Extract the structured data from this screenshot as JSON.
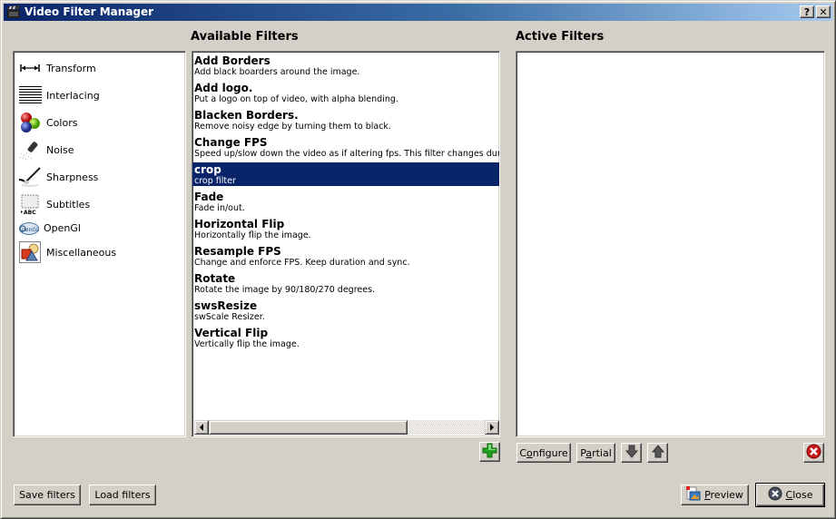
{
  "window": {
    "title": "Video Filter Manager",
    "help_button": "?",
    "close_button": "✕"
  },
  "categories": {
    "items": [
      {
        "label": "Transform",
        "icon": "transform-arrow-icon"
      },
      {
        "label": "Interlacing",
        "icon": "interlacing-lines-icon"
      },
      {
        "label": "Colors",
        "icon": "colors-balls-icon"
      },
      {
        "label": "Noise",
        "icon": "noise-brush-icon"
      },
      {
        "label": "Sharpness",
        "icon": "sharpness-brush-icon"
      },
      {
        "label": "Subtitles",
        "icon": "subtitles-abc-icon"
      },
      {
        "label": "OpenGl",
        "icon": "opengl-logo-icon"
      },
      {
        "label": "Miscellaneous",
        "icon": "misc-shapes-icon"
      }
    ]
  },
  "available": {
    "heading": "Available Filters",
    "selected_index": 4,
    "filters": [
      {
        "name": "Add Borders",
        "desc": "Add black boarders around the image."
      },
      {
        "name": "Add logo.",
        "desc": "Put a logo on top of video, with alpha blending."
      },
      {
        "name": "Blacken Borders.",
        "desc": "Remove noisy edge by turning them to black."
      },
      {
        "name": "Change FPS",
        "desc": "Speed up/slow down the video as if altering fps. This filter changes duration."
      },
      {
        "name": "crop",
        "desc": "crop filter"
      },
      {
        "name": "Fade",
        "desc": "Fade in/out."
      },
      {
        "name": "Horizontal Flip",
        "desc": "Horizontally flip the image."
      },
      {
        "name": "Resample FPS",
        "desc": "Change and enforce FPS. Keep duration and sync."
      },
      {
        "name": "Rotate",
        "desc": "Rotate the image by 90/180/270 degrees."
      },
      {
        "name": "swsResize",
        "desc": "swScale Resizer."
      },
      {
        "name": "Vertical Flip",
        "desc": "Vertically flip the image."
      }
    ]
  },
  "active": {
    "heading": "Active Filters",
    "filters": []
  },
  "buttons": {
    "configure_pre": "C",
    "configure_mnemonic": "o",
    "configure_post": "nfigure",
    "partial_pre": "P",
    "partial_mnemonic": "a",
    "partial_post": "rtial",
    "save_filters": "Save filters",
    "load_filters": "Load filters",
    "preview_mnemonic": "P",
    "preview_post": "review",
    "close_mnemonic": "C",
    "close_post": "lose"
  },
  "colors": {
    "selection": "#0a246a",
    "dialog_bg": "#d4d0c8"
  }
}
